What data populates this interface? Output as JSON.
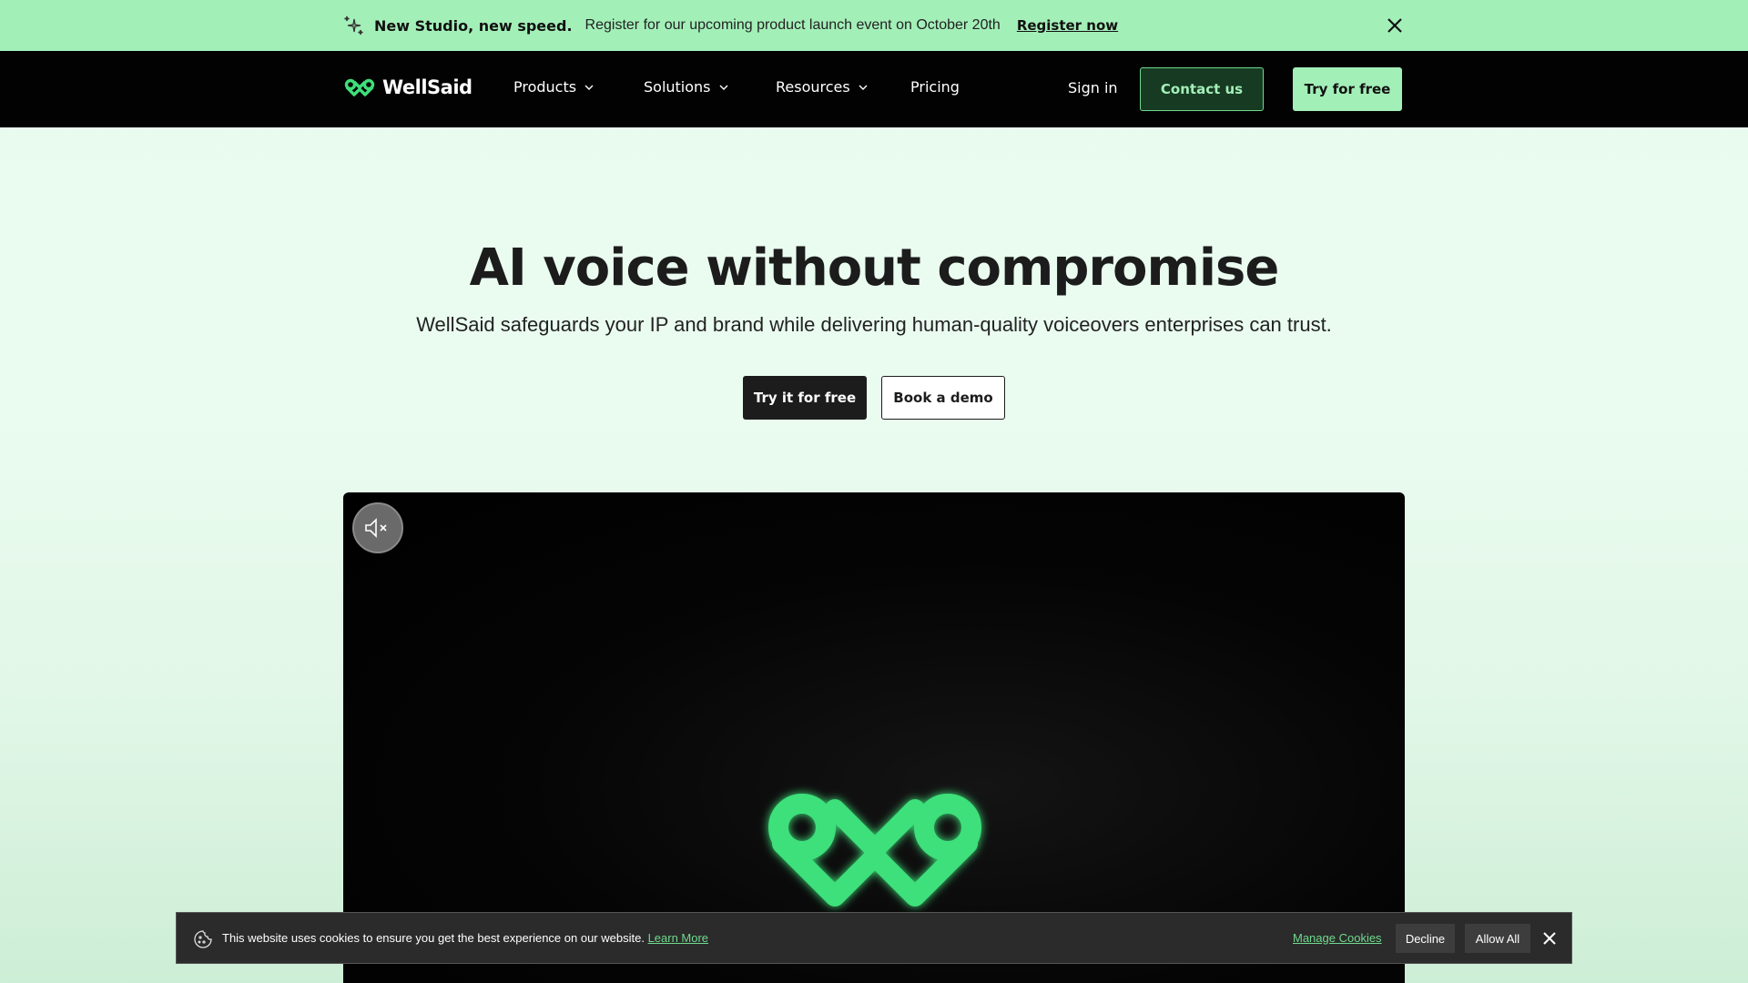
{
  "announcement": {
    "bold": "New Studio, new speed.",
    "text": "Register for our upcoming product launch event on October 20th",
    "link": "Register now"
  },
  "nav": {
    "brand": "WellSaid",
    "items": [
      {
        "label": "Products"
      },
      {
        "label": "Solutions"
      },
      {
        "label": "Resources"
      },
      {
        "label": "Pricing"
      }
    ],
    "sign_in": "Sign in",
    "contact": "Contact us",
    "try_free": "Try for free"
  },
  "hero": {
    "title": "AI voice without compromise",
    "subtitle": "WellSaid safeguards your IP and brand while delivering human-quality voiceovers enterprises can trust.",
    "cta_primary": "Try it for free",
    "cta_secondary": "Book a demo"
  },
  "cookie": {
    "text": "This website uses cookies to ensure you get the best experience on our website.",
    "learn_more": "Learn More",
    "manage": "Manage Cookies",
    "decline": "Decline",
    "allow": "Allow All"
  },
  "colors": {
    "accent_green": "#a3efb8",
    "nav_bg": "#020202",
    "logo_green": "#3de07a"
  },
  "icons": [
    "sparkle-icon",
    "close-icon",
    "chevron-down-icon",
    "mute-icon",
    "cookie-icon",
    "wellsaid-logo"
  ]
}
